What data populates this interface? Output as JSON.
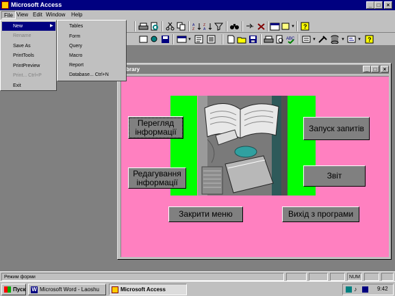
{
  "app": {
    "title": "Microsoft Access"
  },
  "menubar": {
    "items": [
      "File",
      "View",
      "Edit",
      "Window",
      "Help"
    ]
  },
  "file_menu": {
    "items": [
      {
        "label": "New",
        "state": "selected"
      },
      {
        "label": "Rename",
        "state": "disabled"
      },
      {
        "label": "Save As",
        "state": "normal"
      },
      {
        "label": "PrintTools",
        "state": "normal"
      },
      {
        "label": "PrintPreview",
        "state": "normal"
      },
      {
        "label": "Print... Ctrl+P",
        "state": "disabled"
      },
      {
        "label": "Exit",
        "state": "normal"
      }
    ]
  },
  "new_submenu": {
    "items": [
      "Tables",
      "Form",
      "Query",
      "Macro",
      "Report",
      "Database... Ctrl+N"
    ]
  },
  "library_window": {
    "title": "Library",
    "buttons": {
      "view": "Перегляд інформації",
      "edit": "Редагування інформації",
      "queries": "Запуск запитів",
      "report": "Звіт",
      "close_menu": "Закрити меню",
      "exit": "Вихід з програми"
    }
  },
  "statusbar": {
    "text": "Режим форми",
    "indicator": "NUM"
  },
  "taskbar": {
    "start": "Пуск",
    "tasks": [
      "Microsoft Word - Laoshu",
      "Microsoft Access"
    ],
    "clock": "9:42"
  }
}
